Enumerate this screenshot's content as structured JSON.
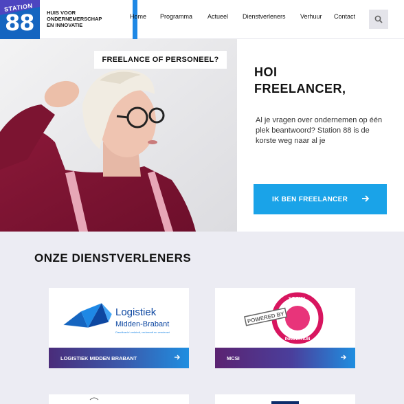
{
  "header": {
    "logo_top": "STATION",
    "logo_number": "88",
    "tagline": [
      "HUIS VOOR",
      "ONDERNEMERSCHAP",
      "EN INNOVATIE"
    ],
    "nav": [
      "Home",
      "Programma",
      "Actueel",
      "Dienstverleners",
      "Verhuur",
      "Contact"
    ],
    "search_icon": "search-icon"
  },
  "hero": {
    "question_tag": "FREELANCE OF PERSONEEL?",
    "title_line1": "HOI",
    "title_line2": "FREELANCER,",
    "text": "Al je vragen over ondernemen op één plek beantwoord? Station 88 is de korste weg naar al je",
    "cta_label": "IK BEN FREELANCER"
  },
  "section": {
    "title": "ONZE DIENSTVERLENERS"
  },
  "cards": [
    {
      "name": "LOGISTIEK MIDDEN BRABANT",
      "logo_line1": "Logistiek",
      "logo_line2": "Midden-Brabant",
      "logo_slogan": "Daadkracht verbindt, verbreedt en vernieuwt"
    },
    {
      "name": "MCSI",
      "logo_powered": "POWERED BY",
      "logo_ring_top": "SOCIAL",
      "logo_ring_bottom": "INNOVATION"
    }
  ],
  "colors": {
    "brand_blue": "#1565c0",
    "accent_blue": "#1aa3e8",
    "purple": "#4a2c7a",
    "magenta": "#d8155f",
    "page_bg": "#ececf3"
  }
}
